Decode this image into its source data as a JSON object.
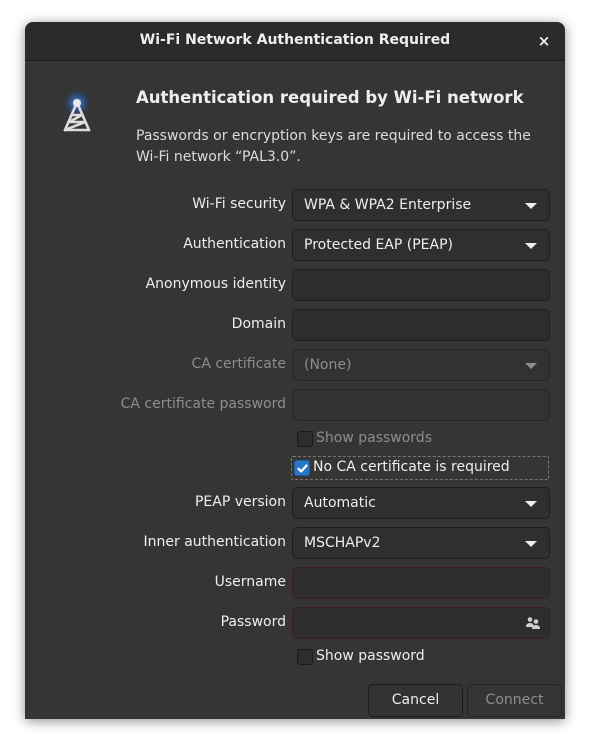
{
  "window": {
    "title": "Wi-Fi Network Authentication Required",
    "close_label": "×"
  },
  "header": {
    "icon": "wifi-tower-icon",
    "heading": "Authentication required by Wi-Fi network",
    "description": "Passwords or encryption keys are required to access the Wi-Fi network “PAL3.0”."
  },
  "form": {
    "wifi_security": {
      "label": "Wi-Fi security",
      "value": "WPA & WPA2 Enterprise"
    },
    "authentication": {
      "label": "Authentication",
      "value": "Protected EAP (PEAP)"
    },
    "anonymous_identity": {
      "label": "Anonymous identity",
      "value": ""
    },
    "domain": {
      "label": "Domain",
      "value": ""
    },
    "ca_certificate": {
      "label": "CA certificate",
      "value": "(None)",
      "disabled": true
    },
    "ca_certificate_password": {
      "label": "CA certificate password",
      "value": "",
      "disabled": true
    },
    "show_passwords": {
      "label": "Show passwords",
      "checked": false,
      "disabled": true
    },
    "no_ca_required": {
      "label": "No CA certificate is required",
      "checked": true
    },
    "peap_version": {
      "label": "PEAP version",
      "value": "Automatic"
    },
    "inner_authentication": {
      "label": "Inner authentication",
      "value": "MSCHAPv2"
    },
    "username": {
      "label": "Username",
      "value": ""
    },
    "password": {
      "label": "Password",
      "value": "",
      "icon": "users-icon"
    },
    "show_password": {
      "label": "Show password",
      "checked": false
    }
  },
  "buttons": {
    "cancel": "Cancel",
    "connect": "Connect"
  },
  "colors": {
    "accent": "#2a76c6",
    "background": "#353535",
    "titlebar": "#2b2b2b"
  }
}
